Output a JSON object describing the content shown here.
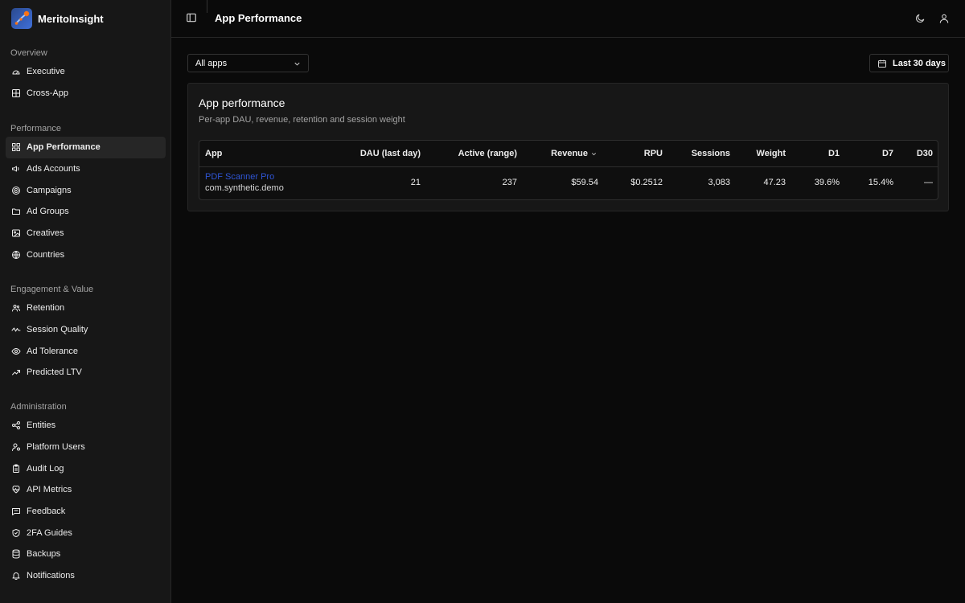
{
  "app": {
    "name": "MeritoInsight"
  },
  "header": {
    "title": "App Performance"
  },
  "sidebar": {
    "groups": [
      {
        "title": "Overview",
        "items": [
          {
            "label": "Executive",
            "icon": "gauge-icon"
          },
          {
            "label": "Cross-App",
            "icon": "grid-icon"
          }
        ]
      },
      {
        "title": "Performance",
        "items": [
          {
            "label": "App Performance",
            "icon": "layout-grid-icon",
            "active": true
          },
          {
            "label": "Ads Accounts",
            "icon": "megaphone-icon"
          },
          {
            "label": "Campaigns",
            "icon": "target-icon"
          },
          {
            "label": "Ad Groups",
            "icon": "folder-icon"
          },
          {
            "label": "Creatives",
            "icon": "image-icon"
          },
          {
            "label": "Countries",
            "icon": "globe-icon"
          }
        ]
      },
      {
        "title": "Engagement & Value",
        "items": [
          {
            "label": "Retention",
            "icon": "users-icon"
          },
          {
            "label": "Session Quality",
            "icon": "activity-icon"
          },
          {
            "label": "Ad Tolerance",
            "icon": "eye-icon"
          },
          {
            "label": "Predicted LTV",
            "icon": "trending-up-icon"
          }
        ]
      },
      {
        "title": "Administration",
        "items": [
          {
            "label": "Entities",
            "icon": "share-nodes-icon"
          },
          {
            "label": "Platform Users",
            "icon": "user-cog-icon"
          },
          {
            "label": "Audit Log",
            "icon": "clipboard-icon"
          },
          {
            "label": "API Metrics",
            "icon": "heart-pulse-icon"
          },
          {
            "label": "Feedback",
            "icon": "message-square-icon"
          },
          {
            "label": "2FA Guides",
            "icon": "shield-check-icon"
          },
          {
            "label": "Backups",
            "icon": "database-icon"
          },
          {
            "label": "Notifications",
            "icon": "bell-icon"
          }
        ]
      }
    ]
  },
  "filters": {
    "app_select": "All apps",
    "date_range": "Last 30 days"
  },
  "card": {
    "title": "App performance",
    "subtitle": "Per-app DAU, revenue, retention and session weight"
  },
  "table": {
    "columns": [
      "App",
      "DAU (last day)",
      "Active (range)",
      "Revenue",
      "RPU",
      "Sessions",
      "Weight",
      "D1",
      "D7",
      "D30"
    ],
    "sorted_by": "Revenue",
    "rows": [
      {
        "app_name": "PDF Scanner Pro",
        "bundle": "com.synthetic.demo",
        "dau": "21",
        "active": "237",
        "revenue": "$59.54",
        "rpu": "$0.2512",
        "sessions": "3,083",
        "weight": "47.23",
        "d1": "39.6%",
        "d7": "15.4%",
        "d30": "—"
      }
    ]
  },
  "colors": {
    "background": "#0a0a0a",
    "sidebar": "#171717",
    "link": "#2f55d4",
    "accent": "#f97316"
  }
}
